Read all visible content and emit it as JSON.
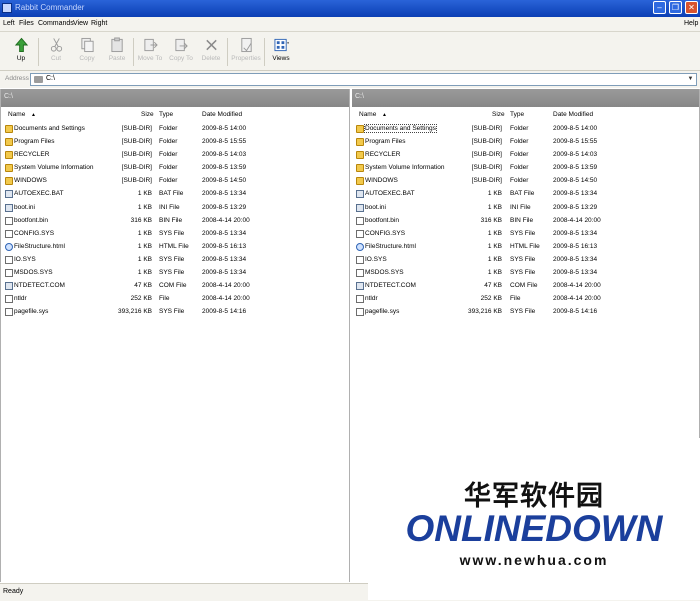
{
  "window": {
    "title": "Rabbit Commander",
    "minimize": "–",
    "restore": "❐",
    "close": "✕"
  },
  "menu": {
    "items": [
      "Left",
      "Files",
      "Commands",
      "View",
      "Right"
    ],
    "help": "Help"
  },
  "toolbar": {
    "buttons": [
      {
        "label": "Up",
        "icon": "up-arrow-icon",
        "enabled": true
      },
      {
        "label": "Cut",
        "icon": "scissors-icon",
        "enabled": false
      },
      {
        "label": "Copy",
        "icon": "copy-icon",
        "enabled": false
      },
      {
        "label": "Paste",
        "icon": "paste-icon",
        "enabled": false
      },
      {
        "label": "Move To",
        "icon": "move-to-icon",
        "enabled": false
      },
      {
        "label": "Copy To",
        "icon": "copy-to-icon",
        "enabled": false
      },
      {
        "label": "Delete",
        "icon": "delete-icon",
        "enabled": false
      },
      {
        "label": "Properties",
        "icon": "properties-icon",
        "enabled": false
      },
      {
        "label": "Views",
        "icon": "views-icon",
        "enabled": true
      }
    ]
  },
  "address": {
    "label": "Address",
    "value": "C:\\"
  },
  "columns": {
    "name": "Name",
    "size": "Size",
    "type": "Type",
    "modified": "Date Modified"
  },
  "left_pane": {
    "path": "C:\\"
  },
  "right_pane": {
    "path": "C:\\",
    "selected_index": 0
  },
  "files": [
    {
      "name": "Documents and Settings",
      "size": "[SUB-DIR]",
      "type": "Folder",
      "modified": "2009-8-5 14:00",
      "icon": "folder"
    },
    {
      "name": "Program Files",
      "size": "[SUB-DIR]",
      "type": "Folder",
      "modified": "2009-8-5 15:55",
      "icon": "folder"
    },
    {
      "name": "RECYCLER",
      "size": "[SUB-DIR]",
      "type": "Folder",
      "modified": "2009-8-5 14:03",
      "icon": "folder"
    },
    {
      "name": "System Volume Information",
      "size": "[SUB-DIR]",
      "type": "Folder",
      "modified": "2009-8-5 13:59",
      "icon": "folder"
    },
    {
      "name": "WINDOWS",
      "size": "[SUB-DIR]",
      "type": "Folder",
      "modified": "2009-8-5 14:50",
      "icon": "folder"
    },
    {
      "name": "AUTOEXEC.BAT",
      "size": "1 KB",
      "type": "BAT File",
      "modified": "2009-8-5 13:34",
      "icon": "sys"
    },
    {
      "name": "boot.ini",
      "size": "1 KB",
      "type": "INI File",
      "modified": "2009-8-5 13:29",
      "icon": "sys"
    },
    {
      "name": "bootfont.bin",
      "size": "316 KB",
      "type": "BIN File",
      "modified": "2008-4-14 20:00",
      "icon": "file"
    },
    {
      "name": "CONFIG.SYS",
      "size": "1 KB",
      "type": "SYS File",
      "modified": "2009-8-5 13:34",
      "icon": "file"
    },
    {
      "name": "FileStructure.html",
      "size": "1 KB",
      "type": "HTML File",
      "modified": "2009-8-5 16:13",
      "icon": "html"
    },
    {
      "name": "IO.SYS",
      "size": "1 KB",
      "type": "SYS File",
      "modified": "2009-8-5 13:34",
      "icon": "file"
    },
    {
      "name": "MSDOS.SYS",
      "size": "1 KB",
      "type": "SYS File",
      "modified": "2009-8-5 13:34",
      "icon": "file"
    },
    {
      "name": "NTDETECT.COM",
      "size": "47 KB",
      "type": "COM File",
      "modified": "2008-4-14 20:00",
      "icon": "sys"
    },
    {
      "name": "ntldr",
      "size": "252 KB",
      "type": "File",
      "modified": "2008-4-14 20:00",
      "icon": "file"
    },
    {
      "name": "pagefile.sys",
      "size": "393,216 KB",
      "type": "SYS File",
      "modified": "2009-8-5 14:16",
      "icon": "file"
    }
  ],
  "status": {
    "text": "Ready"
  },
  "watermark": {
    "cn": "华军软件园",
    "brand": "ONLINEDOWN",
    "url": "www.newhua.com"
  },
  "colors": {
    "title_bar": "#0b3fb4",
    "pane_header": "#8f8f8f",
    "brand": "#1b3f9c"
  }
}
